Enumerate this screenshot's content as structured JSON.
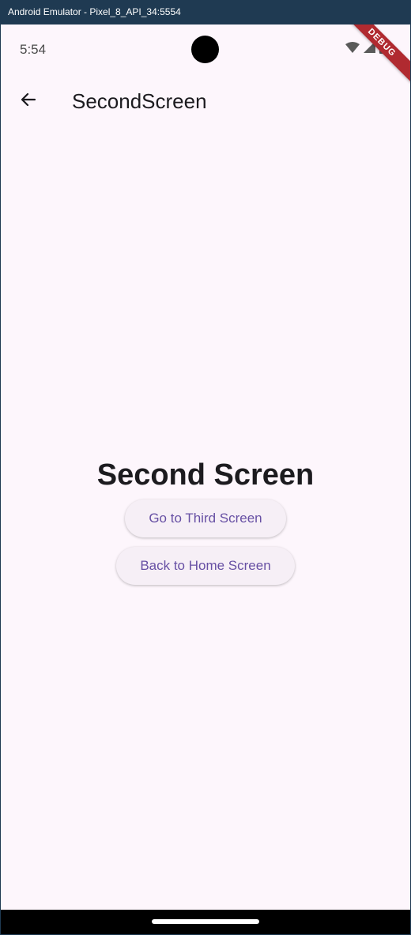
{
  "window": {
    "title": "Android Emulator - Pixel_8_API_34:5554"
  },
  "statusbar": {
    "time": "5:54",
    "icons": [
      "wifi-icon",
      "signal-icon",
      "battery-icon"
    ],
    "debug_banner": "DEBUG"
  },
  "appbar": {
    "back_icon": "arrow-back-icon",
    "title": "SecondScreen"
  },
  "main": {
    "heading": "Second Screen",
    "buttons": [
      {
        "label": "Go to Third Screen"
      },
      {
        "label": "Back to Home Screen"
      }
    ]
  },
  "colors": {
    "background": "#fdf6fc",
    "accent": "#6750a4",
    "debug_ribbon": "#b02a30",
    "window_frame": "#1f3a52"
  }
}
